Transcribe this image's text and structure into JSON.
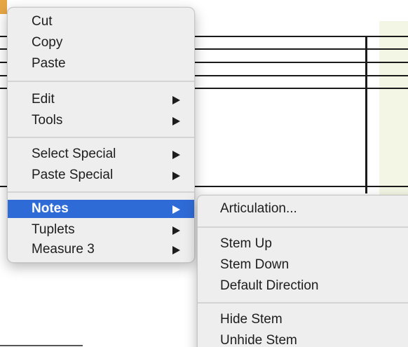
{
  "context_menu": {
    "items": [
      {
        "label": "Cut"
      },
      {
        "label": "Copy"
      },
      {
        "label": "Paste"
      },
      {
        "label": "Edit",
        "has_submenu": true
      },
      {
        "label": "Tools",
        "has_submenu": true
      },
      {
        "label": "Select Special",
        "has_submenu": true
      },
      {
        "label": "Paste Special",
        "has_submenu": true
      },
      {
        "label": "Notes",
        "has_submenu": true,
        "selected": true
      },
      {
        "label": "Tuplets",
        "has_submenu": true
      },
      {
        "label": "Measure 3",
        "has_submenu": true
      }
    ]
  },
  "notes_submenu": {
    "items": [
      {
        "label": "Articulation..."
      },
      {
        "label": "Stem Up"
      },
      {
        "label": "Stem Down"
      },
      {
        "label": "Default Direction"
      },
      {
        "label": "Hide Stem"
      },
      {
        "label": "Unhide Stem"
      }
    ]
  },
  "colors": {
    "selection": "#2f6bd6",
    "menu_background": "#eeeeee",
    "measure_highlight": "#f3f6e4"
  },
  "icons": {
    "submenu_arrow": "triangle-right-icon"
  }
}
